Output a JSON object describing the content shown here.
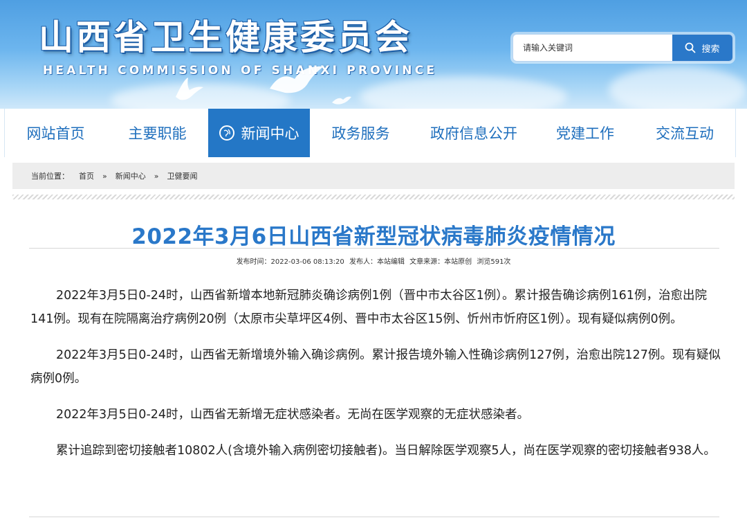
{
  "header": {
    "logo_cn": "山西省卫生健康委员会",
    "logo_en": "HEALTH COMMISSION OF SHANXI PROVINCE",
    "search": {
      "placeholder": "请输入关键词",
      "button_label": "搜索"
    }
  },
  "nav": {
    "items": [
      {
        "label": "网站首页"
      },
      {
        "label": "主要职能"
      },
      {
        "label": "新闻中心",
        "active": true
      },
      {
        "label": "政务服务"
      },
      {
        "label": "政府信息公开"
      },
      {
        "label": "党建工作"
      },
      {
        "label": "交流互动"
      }
    ]
  },
  "breadcrumb": {
    "prefix": "当前位置：",
    "items": [
      "首页",
      "新闻中心",
      "卫健要闻"
    ],
    "separator": "»"
  },
  "article": {
    "title": "2022年3月6日山西省新型冠状病毒肺炎疫情情况",
    "meta": {
      "publish_time": "发布时间：2022-03-06 08:13:20",
      "publisher": "发布人：本站编辑",
      "source": "文章来源：本站原创",
      "views": "浏览591次"
    },
    "paragraphs": [
      "2022年3月5日0-24时，山西省新增本地新冠肺炎确诊病例1例（晋中市太谷区1例）。累计报告确诊病例161例，治愈出院141例。现有在院隔离治疗病例20例（太原市尖草坪区4例、晋中市太谷区15例、忻州市忻府区1例）。现有疑似病例0例。",
      "2022年3月5日0-24时，山西省无新增境外输入确诊病例。累计报告境外输入性确诊病例127例，治愈出院127例。现有疑似病例0例。",
      "2022年3月5日0-24时，山西省无新增无症状感染者。无尚在医学观察的无症状感染者。",
      "累计追踪到密切接触者10802人(含境外输入病例密切接触者)。当日解除医学观察5人，尚在医学观察的密切接触者938人。"
    ]
  },
  "colors": {
    "brand_blue": "#2477c6",
    "title_blue": "#2a78c9"
  }
}
